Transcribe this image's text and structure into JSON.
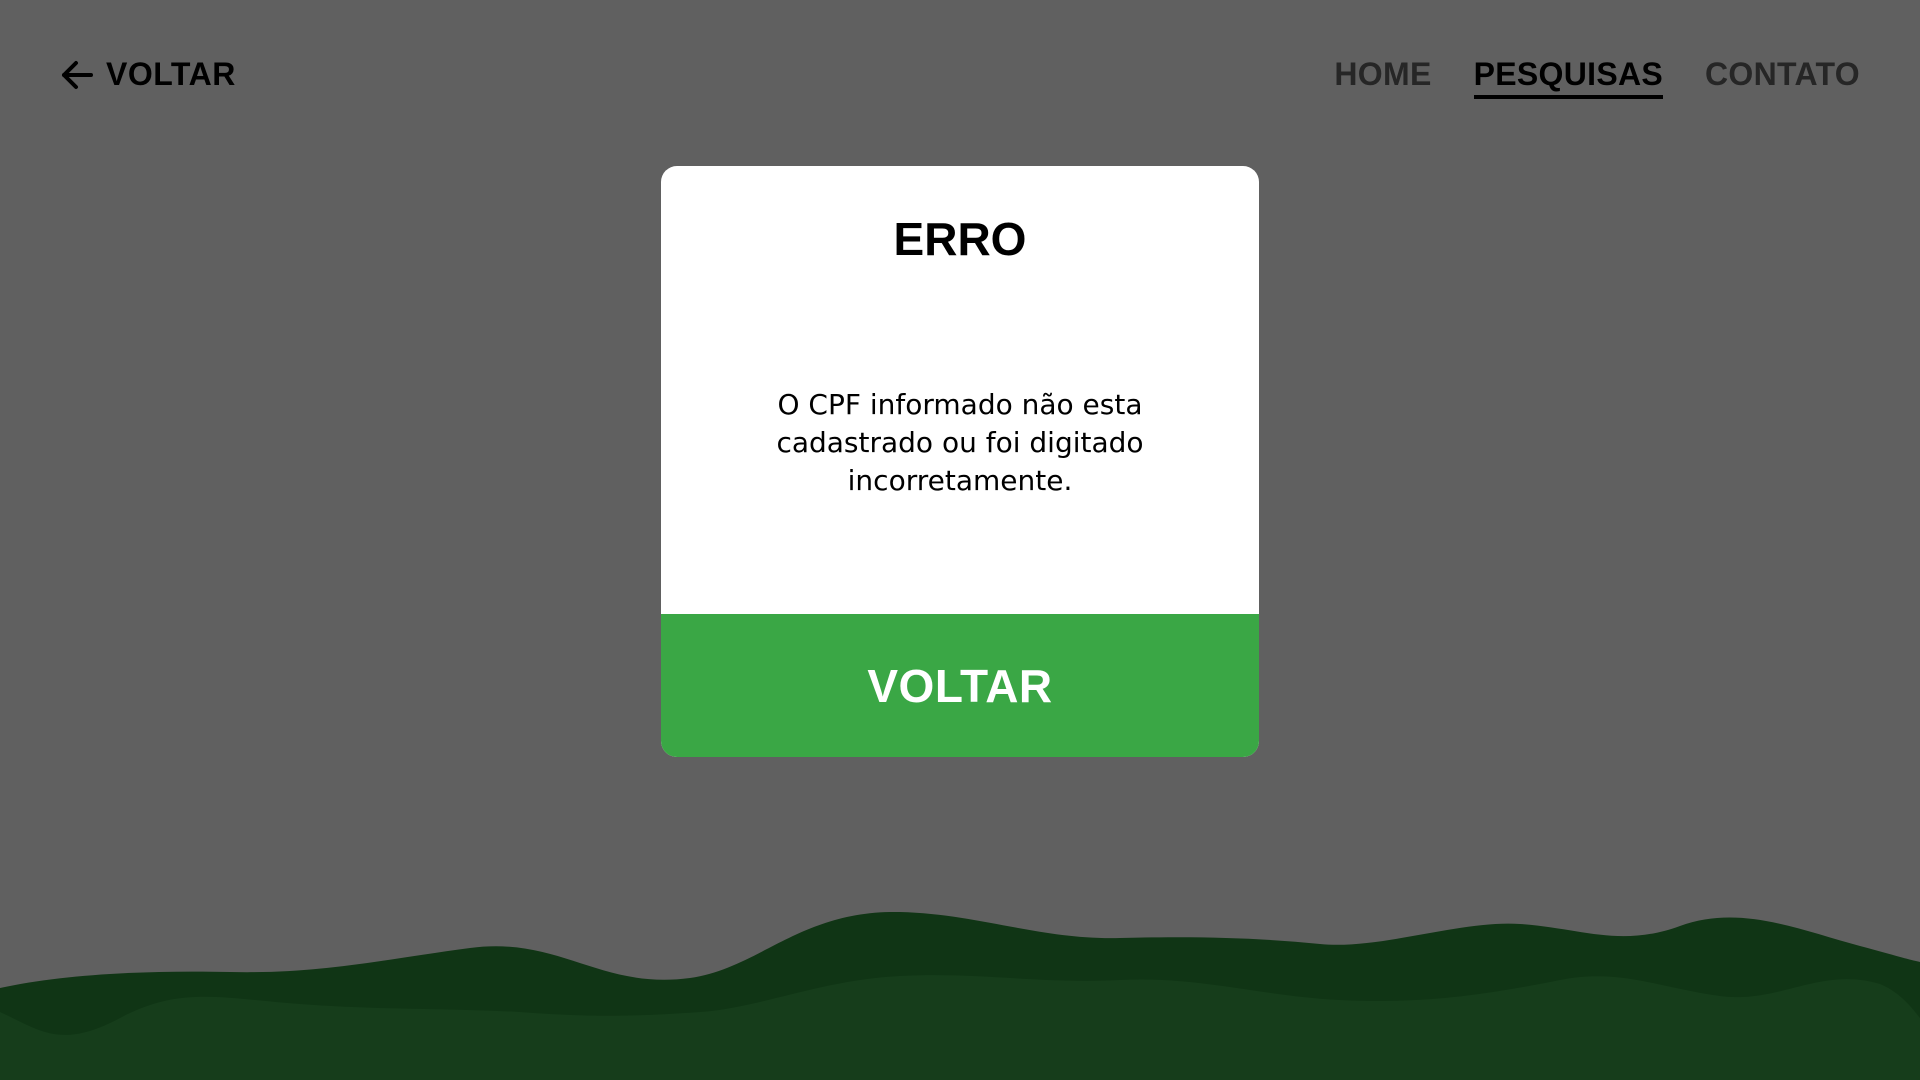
{
  "header": {
    "back_label": "VOLTAR",
    "back_icon": "arrow-left-icon",
    "nav": [
      {
        "label": "HOME",
        "active": false
      },
      {
        "label": "PESQUISAS",
        "active": true
      },
      {
        "label": "CONTATO",
        "active": false
      }
    ]
  },
  "modal": {
    "title": "ERRO",
    "message": "O CPF informado não esta cadastrado ou foi digitado incorretamente.",
    "button_label": "VOLTAR"
  },
  "colors": {
    "overlay_background": "#606060",
    "button_green": "#3aa745",
    "wave_dark": "#103515",
    "wave_mid": "#163d1b"
  }
}
